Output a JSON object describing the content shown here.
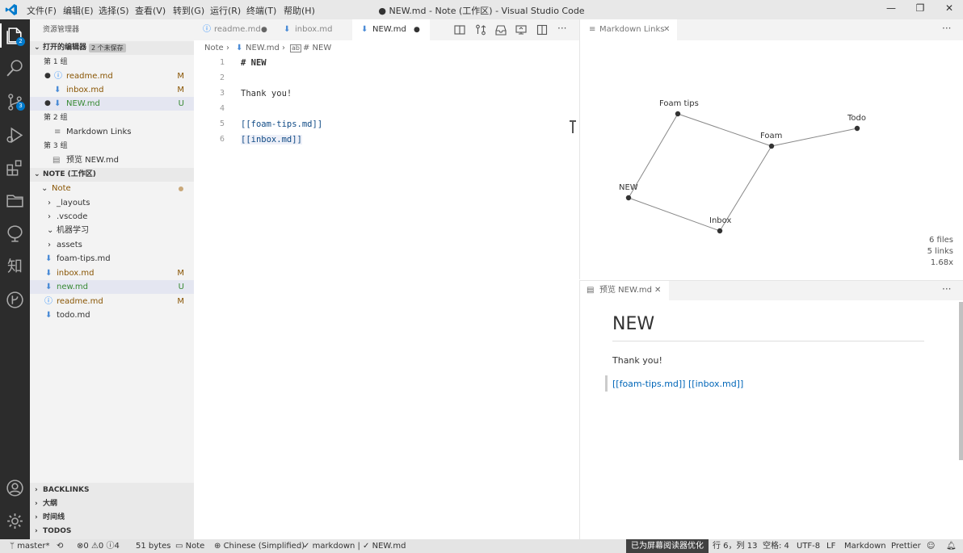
{
  "window": {
    "title": "● NEW.md - Note (工作区) - Visual Studio Code",
    "menu": [
      "文件(F)",
      "编辑(E)",
      "选择(S)",
      "查看(V)",
      "转到(G)",
      "运行(R)",
      "终端(T)",
      "帮助(H)"
    ]
  },
  "activity": {
    "explorer_badge": "2",
    "scm_badge": "3"
  },
  "sidebar": {
    "title": "资源管理器",
    "open_editors_header": "打开的编辑器",
    "unsaved_label": "2 个未保存",
    "group1": "第 1 组",
    "group1_files": [
      {
        "name": "readme.md",
        "flag": "M"
      },
      {
        "name": "inbox.md",
        "flag": "M"
      },
      {
        "name": "NEW.md",
        "flag": "U"
      }
    ],
    "group2": "第 2 组",
    "group2_item": "Markdown Links",
    "group3": "第 3 组",
    "group3_item": "预览 NEW.md",
    "workspace_header": "NOTE (工作区)",
    "root_folder": "Note",
    "tree": [
      {
        "name": "_layouts"
      },
      {
        "name": ".vscode"
      },
      {
        "name": "机器学习"
      },
      {
        "name": "assets"
      },
      {
        "name": "foam-tips.md"
      },
      {
        "name": "inbox.md",
        "flag": "M"
      },
      {
        "name": "new.md",
        "flag": "U"
      },
      {
        "name": "readme.md",
        "flag": "M"
      },
      {
        "name": "todo.md"
      }
    ],
    "bottom_sections": [
      "BACKLINKS",
      "大纲",
      "时间线",
      "TODOS"
    ]
  },
  "editor": {
    "tabs": [
      "readme.md",
      "inbox.md",
      "NEW.md"
    ],
    "breadcrumb": [
      "Note",
      "NEW.md",
      "# NEW"
    ],
    "line_numbers": [
      "1",
      "2",
      "3",
      "4",
      "5",
      "6"
    ],
    "lines": [
      "# NEW",
      "",
      "Thank you!",
      "",
      "[[foam-tips.md]]",
      "[[inbox.md]]"
    ]
  },
  "graph": {
    "tab_label": "Markdown Links",
    "nodes": [
      "Foam tips",
      "Foam",
      "Todo",
      "NEW",
      "Inbox"
    ],
    "stats": [
      "6 files",
      "5 links",
      "1.68x"
    ]
  },
  "preview": {
    "tab_label": "预览 NEW.md",
    "heading": "NEW",
    "para": "Thank you!",
    "link1": "[[foam-tips.md]]",
    "link2": "[[inbox.md]]"
  },
  "status": {
    "branch": "master*",
    "problems": "0",
    "warnings": "0",
    "info": "4",
    "size": "51 bytes",
    "folder": "Note",
    "language_pack": "Chinese (Simplified)",
    "lint": "markdown | ✓ NEW.md",
    "screen_reader": "已为屏幕阅读器优化",
    "position": "行 6，列 13",
    "indent": "空格: 4",
    "encoding": "UTF-8",
    "eol": "LF",
    "mode": "Markdown",
    "formatter": "Prettier"
  }
}
